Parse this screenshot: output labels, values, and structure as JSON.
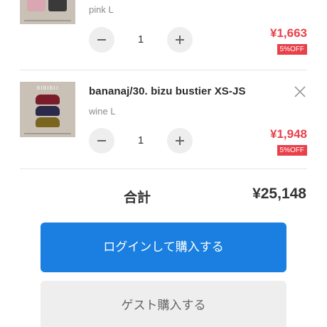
{
  "cart": {
    "items": [
      {
        "name": "",
        "variant": "pink L",
        "quantity": "1",
        "price": "¥1,663",
        "discount_badge": "5%OFF"
      },
      {
        "name": "bananaj/30. bizu bustier XS-JS",
        "variant": "wine L",
        "quantity": "1",
        "price": "¥1,948",
        "discount_badge": "5%OFF",
        "thumb_brand": "BIBIBIJ"
      }
    ]
  },
  "summary": {
    "total_label": "合計",
    "total_value": "¥25,148"
  },
  "actions": {
    "login_purchase": "ログインして購入する",
    "guest_purchase": "ゲスト購入する"
  },
  "icons": {
    "minus": "minus-icon",
    "plus": "plus-icon",
    "close": "close-icon"
  },
  "colors": {
    "price_red": "#e8414b",
    "primary_blue": "#1a7fe0",
    "button_gray": "#eeeeee"
  }
}
